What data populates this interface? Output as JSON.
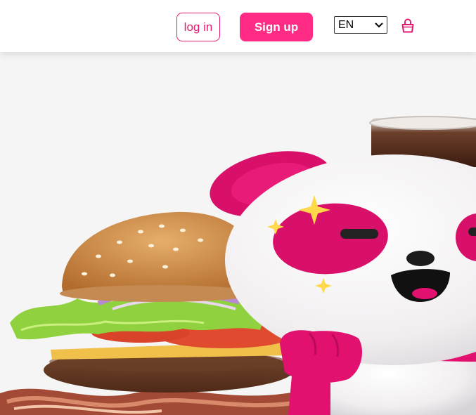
{
  "header": {
    "login_label": "log in",
    "signup_label": "Sign up",
    "language": {
      "selected": "EN"
    },
    "icons": {
      "language_dropdown": "chevron-down-icon",
      "cart": "shopping-bag-icon"
    }
  },
  "hero": {
    "image": "burger-with-panda-mascot"
  },
  "colors": {
    "brand_pink": "#e21b70",
    "signup_pink": "#ff2b85",
    "background": "#f5f5f5"
  }
}
